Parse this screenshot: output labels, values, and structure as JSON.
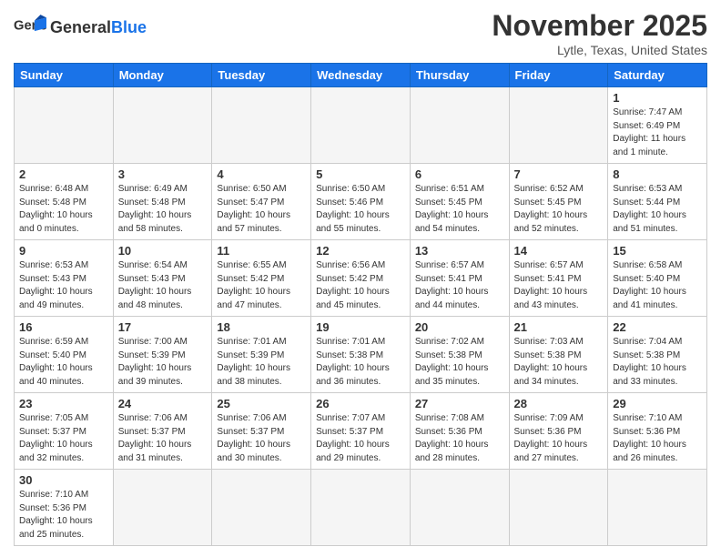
{
  "header": {
    "logo_general": "General",
    "logo_blue": "Blue",
    "month": "November 2025",
    "location": "Lytle, Texas, United States"
  },
  "weekdays": [
    "Sunday",
    "Monday",
    "Tuesday",
    "Wednesday",
    "Thursday",
    "Friday",
    "Saturday"
  ],
  "weeks": [
    [
      {
        "day": "",
        "info": ""
      },
      {
        "day": "",
        "info": ""
      },
      {
        "day": "",
        "info": ""
      },
      {
        "day": "",
        "info": ""
      },
      {
        "day": "",
        "info": ""
      },
      {
        "day": "",
        "info": ""
      },
      {
        "day": "1",
        "info": "Sunrise: 7:47 AM\nSunset: 6:49 PM\nDaylight: 11 hours\nand 1 minute."
      }
    ],
    [
      {
        "day": "2",
        "info": "Sunrise: 6:48 AM\nSunset: 5:48 PM\nDaylight: 10 hours\nand 0 minutes."
      },
      {
        "day": "3",
        "info": "Sunrise: 6:49 AM\nSunset: 5:48 PM\nDaylight: 10 hours\nand 58 minutes."
      },
      {
        "day": "4",
        "info": "Sunrise: 6:50 AM\nSunset: 5:47 PM\nDaylight: 10 hours\nand 57 minutes."
      },
      {
        "day": "5",
        "info": "Sunrise: 6:50 AM\nSunset: 5:46 PM\nDaylight: 10 hours\nand 55 minutes."
      },
      {
        "day": "6",
        "info": "Sunrise: 6:51 AM\nSunset: 5:45 PM\nDaylight: 10 hours\nand 54 minutes."
      },
      {
        "day": "7",
        "info": "Sunrise: 6:52 AM\nSunset: 5:45 PM\nDaylight: 10 hours\nand 52 minutes."
      },
      {
        "day": "8",
        "info": "Sunrise: 6:53 AM\nSunset: 5:44 PM\nDaylight: 10 hours\nand 51 minutes."
      }
    ],
    [
      {
        "day": "9",
        "info": "Sunrise: 6:53 AM\nSunset: 5:43 PM\nDaylight: 10 hours\nand 49 minutes."
      },
      {
        "day": "10",
        "info": "Sunrise: 6:54 AM\nSunset: 5:43 PM\nDaylight: 10 hours\nand 48 minutes."
      },
      {
        "day": "11",
        "info": "Sunrise: 6:55 AM\nSunset: 5:42 PM\nDaylight: 10 hours\nand 47 minutes."
      },
      {
        "day": "12",
        "info": "Sunrise: 6:56 AM\nSunset: 5:42 PM\nDaylight: 10 hours\nand 45 minutes."
      },
      {
        "day": "13",
        "info": "Sunrise: 6:57 AM\nSunset: 5:41 PM\nDaylight: 10 hours\nand 44 minutes."
      },
      {
        "day": "14",
        "info": "Sunrise: 6:57 AM\nSunset: 5:41 PM\nDaylight: 10 hours\nand 43 minutes."
      },
      {
        "day": "15",
        "info": "Sunrise: 6:58 AM\nSunset: 5:40 PM\nDaylight: 10 hours\nand 41 minutes."
      }
    ],
    [
      {
        "day": "16",
        "info": "Sunrise: 6:59 AM\nSunset: 5:40 PM\nDaylight: 10 hours\nand 40 minutes."
      },
      {
        "day": "17",
        "info": "Sunrise: 7:00 AM\nSunset: 5:39 PM\nDaylight: 10 hours\nand 39 minutes."
      },
      {
        "day": "18",
        "info": "Sunrise: 7:01 AM\nSunset: 5:39 PM\nDaylight: 10 hours\nand 38 minutes."
      },
      {
        "day": "19",
        "info": "Sunrise: 7:01 AM\nSunset: 5:38 PM\nDaylight: 10 hours\nand 36 minutes."
      },
      {
        "day": "20",
        "info": "Sunrise: 7:02 AM\nSunset: 5:38 PM\nDaylight: 10 hours\nand 35 minutes."
      },
      {
        "day": "21",
        "info": "Sunrise: 7:03 AM\nSunset: 5:38 PM\nDaylight: 10 hours\nand 34 minutes."
      },
      {
        "day": "22",
        "info": "Sunrise: 7:04 AM\nSunset: 5:38 PM\nDaylight: 10 hours\nand 33 minutes."
      }
    ],
    [
      {
        "day": "23",
        "info": "Sunrise: 7:05 AM\nSunset: 5:37 PM\nDaylight: 10 hours\nand 32 minutes."
      },
      {
        "day": "24",
        "info": "Sunrise: 7:06 AM\nSunset: 5:37 PM\nDaylight: 10 hours\nand 31 minutes."
      },
      {
        "day": "25",
        "info": "Sunrise: 7:06 AM\nSunset: 5:37 PM\nDaylight: 10 hours\nand 30 minutes."
      },
      {
        "day": "26",
        "info": "Sunrise: 7:07 AM\nSunset: 5:37 PM\nDaylight: 10 hours\nand 29 minutes."
      },
      {
        "day": "27",
        "info": "Sunrise: 7:08 AM\nSunset: 5:36 PM\nDaylight: 10 hours\nand 28 minutes."
      },
      {
        "day": "28",
        "info": "Sunrise: 7:09 AM\nSunset: 5:36 PM\nDaylight: 10 hours\nand 27 minutes."
      },
      {
        "day": "29",
        "info": "Sunrise: 7:10 AM\nSunset: 5:36 PM\nDaylight: 10 hours\nand 26 minutes."
      }
    ],
    [
      {
        "day": "30",
        "info": "Sunrise: 7:10 AM\nSunset: 5:36 PM\nDaylight: 10 hours\nand 25 minutes."
      },
      {
        "day": "",
        "info": ""
      },
      {
        "day": "",
        "info": ""
      },
      {
        "day": "",
        "info": ""
      },
      {
        "day": "",
        "info": ""
      },
      {
        "day": "",
        "info": ""
      },
      {
        "day": "",
        "info": ""
      }
    ]
  ]
}
